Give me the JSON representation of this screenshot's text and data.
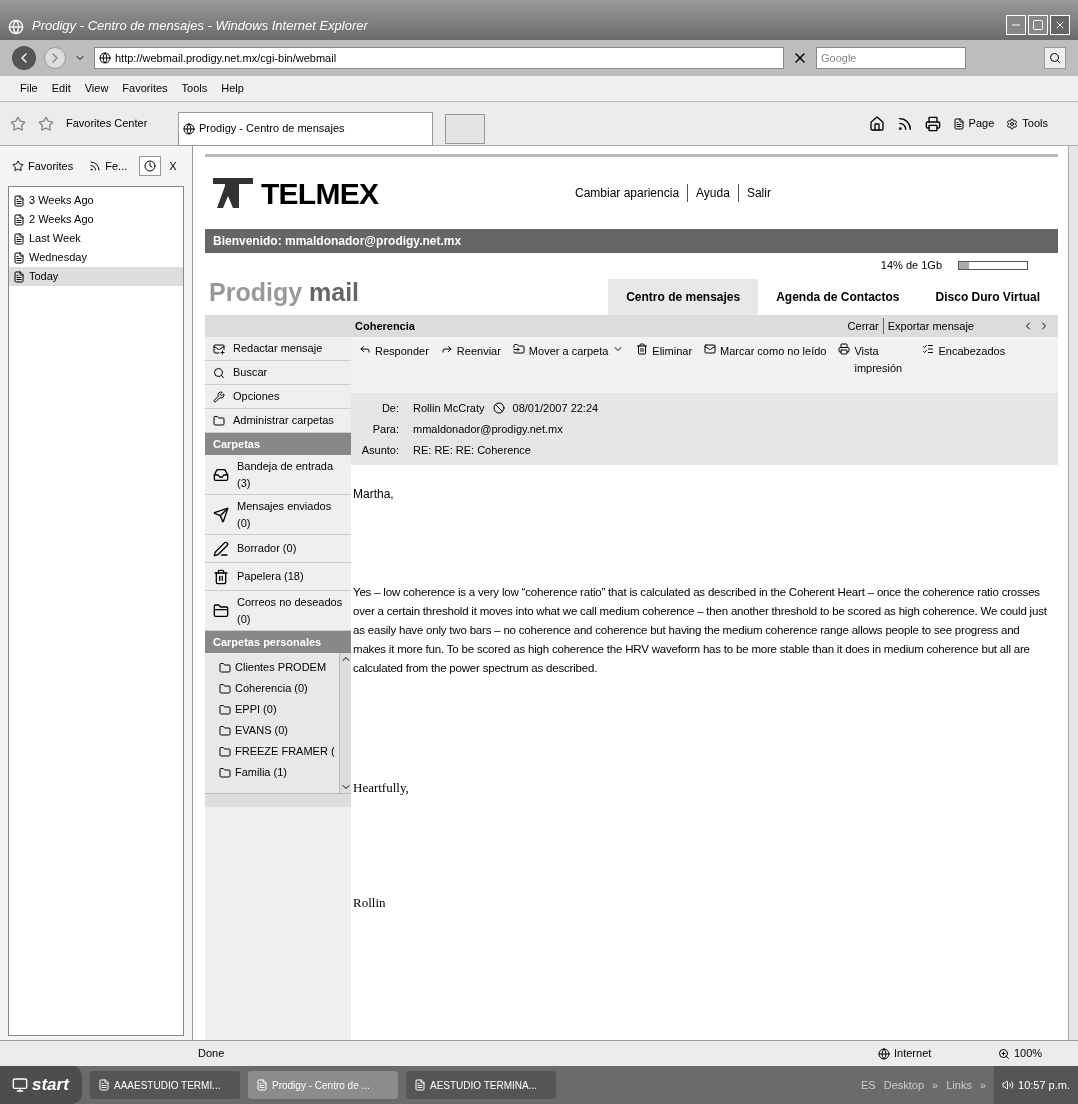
{
  "window": {
    "title": "Prodigy - Centro de mensajes - Windows Internet Explorer"
  },
  "address_bar": {
    "url": "http://webmail.prodigy.net.mx/cgi-bin/webmail",
    "search_placeholder": "Google"
  },
  "menu": [
    "File",
    "Edit",
    "View",
    "Favorites",
    "Tools",
    "Help"
  ],
  "favorites_center": {
    "label": "Favorites Center"
  },
  "browser_tab": {
    "title": "Prodigy - Centro de mensajes"
  },
  "command_bar": [
    "Page",
    "Tools"
  ],
  "favorites_panel": {
    "tabs": [
      {
        "label": "Favorites",
        "selected": false
      },
      {
        "label": "Fe...",
        "selected": false
      }
    ],
    "close": "X",
    "items": [
      {
        "label": "3 Weeks Ago",
        "selected": false
      },
      {
        "label": "2 Weeks Ago",
        "selected": false
      },
      {
        "label": "Last Week",
        "selected": false
      },
      {
        "label": "Wednesday",
        "selected": false
      },
      {
        "label": "Today",
        "selected": true
      }
    ]
  },
  "webmail": {
    "logo": "TELMEX",
    "top_links": [
      "Cambiar apariencia",
      "Ayuda",
      "Salir"
    ],
    "welcome": "Bienvenido: mmaldonador@prodigy.net.mx",
    "quota": {
      "reading": "14% de 1Gb",
      "level": 0.14
    },
    "brand": {
      "first": "Prodigy",
      "second": "mail"
    },
    "tabs": [
      {
        "label": "Centro de mensajes",
        "selected": true
      },
      {
        "label": "Agenda de Contactos",
        "selected": false
      },
      {
        "label": "Disco Duro Virtual",
        "selected": false
      }
    ],
    "message_bar": {
      "subject": "Coherencia",
      "links": [
        "Cerrar",
        "Exportar mensaje"
      ]
    },
    "actions": [
      "Redactar mensaje",
      "Buscar",
      "Opciones",
      "Administrar carpetas"
    ],
    "folders_heading": "Carpetas",
    "folders": [
      "Bandeja de entrada (3)",
      "Mensajes enviados (0)",
      "Borrador (0)",
      "Papelera (18)",
      "Correos no deseados (0)"
    ],
    "personal_heading": "Carpetas personales",
    "personal_folders": [
      "Clientes PRODEM",
      "Coherencia (0)",
      "EPPI (0)",
      "EVANS (0)",
      "FREEZE FRAMER (",
      "Familia (1)"
    ],
    "toolbar": [
      {
        "kind": "reply",
        "label": "Responder"
      },
      {
        "kind": "forward",
        "label": "Reenviar"
      },
      {
        "kind": "move",
        "label": "Mover a carpeta"
      },
      {
        "kind": "delete",
        "label": "Eliminar"
      },
      {
        "kind": "unread",
        "label": "Marcar como no leído"
      },
      {
        "kind": "print",
        "label": "Vista impresión"
      },
      {
        "kind": "headers",
        "label": "Encabezados"
      }
    ],
    "header": [
      {
        "label": "De:",
        "value": "Rollin McCraty",
        "date": "08/01/2007 22:24"
      },
      {
        "label": "Para:",
        "value": "mmaldonador@prodigy.net.mx"
      },
      {
        "label": "Asunto:",
        "value": "RE: RE: RE: Coherence"
      }
    ],
    "body": {
      "greeting": "Martha,",
      "paragraph": "Yes – low coherence is a very low “coherence ratio” that is calculated as described in the Coherent Heart – once the coherence ratio crosses over a certain threshold it moves into what we call medium coherence – then another threshold  to be scored as high coherence. We could just as easily have only two bars – no coherence and coherence but having the medium coherence range allows people to see progress and makes it more fun. To be scored as high coherence the HRV waveform has to be more stable than it does in medium coherence but all are calculated from the power spectrum as described.",
      "closing": "Heartfully,",
      "signature": "Rollin"
    }
  },
  "status_bar": {
    "status": "Done",
    "zone": "Internet",
    "zoom": "100%"
  },
  "taskbar": {
    "start": "start",
    "windows": [
      {
        "label": "AAAESTUDIO TERMI...",
        "selected": false
      },
      {
        "label": "Prodigy - Centro de ...",
        "selected": true
      },
      {
        "label": "AESTUDIO TERMINA...",
        "selected": false
      }
    ],
    "language": "ES",
    "toolbars": [
      "Desktop",
      "»",
      "Links",
      "»"
    ],
    "clock": "10:57 p.m."
  }
}
